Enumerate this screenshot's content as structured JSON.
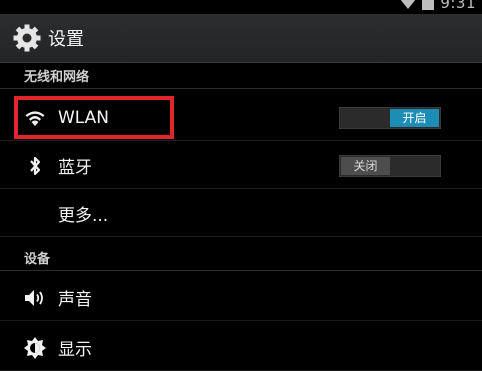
{
  "status_bar": {
    "time": "9:31"
  },
  "action_bar": {
    "title": "设置",
    "icon": "gear-icon"
  },
  "sections": {
    "wireless": {
      "header": "无线和网络",
      "items": [
        {
          "label": "WLAN",
          "icon": "wifi-icon",
          "toggle": "开启",
          "toggle_state": "on"
        },
        {
          "label": "蓝牙",
          "icon": "bluetooth-icon",
          "toggle": "关闭",
          "toggle_state": "off"
        },
        {
          "label": "更多..."
        }
      ]
    },
    "device": {
      "header": "设备",
      "items": [
        {
          "label": "声音",
          "icon": "volume-icon"
        },
        {
          "label": "显示",
          "icon": "brightness-icon"
        }
      ]
    }
  },
  "colors": {
    "accent": "#1d8db6",
    "highlight": "#e0262b"
  }
}
